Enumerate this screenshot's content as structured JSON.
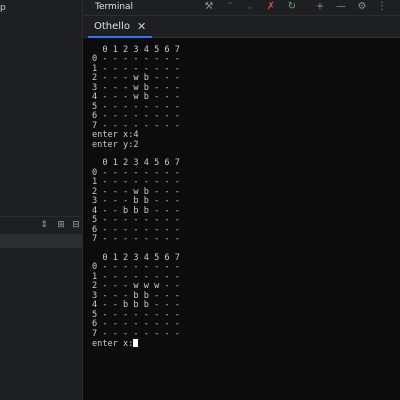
{
  "left_panel": {
    "top_text": "p"
  },
  "header": {
    "title": "Terminal",
    "icons": [
      "build-icon",
      "arrow-up-icon",
      "arrow-down-icon",
      "stop-icon",
      "rerun-icon",
      "add-icon",
      "minimize-icon",
      "gear-icon",
      "more-icon"
    ]
  },
  "tab": {
    "label": "Othello",
    "close": "✕"
  },
  "terminal": {
    "lines": [
      "  0 1 2 3 4 5 6 7",
      "0 - - - - - - - -",
      "1 - - - - - - - -",
      "2 - - - w b - - -",
      "3 - - - w b - - -",
      "4 - - - w b - - -",
      "5 - - - - - - - -",
      "6 - - - - - - - -",
      "7 - - - - - - - -",
      "enter x:4",
      "enter y:2",
      "",
      "  0 1 2 3 4 5 6 7",
      "0 - - - - - - - -",
      "1 - - - - - - - -",
      "2 - - - w b - - -",
      "3 - - - b b - - -",
      "4 - - b b b - - -",
      "5 - - - - - - - -",
      "6 - - - - - - - -",
      "7 - - - - - - - -",
      "",
      "  0 1 2 3 4 5 6 7",
      "0 - - - - - - - -",
      "1 - - - - - - - -",
      "2 - - - w w w - -",
      "3 - - - b b - - -",
      "4 - - b b b - - -",
      "5 - - - - - - - -",
      "6 - - - - - - - -",
      "7 - - - - - - - -",
      "enter x:"
    ]
  }
}
